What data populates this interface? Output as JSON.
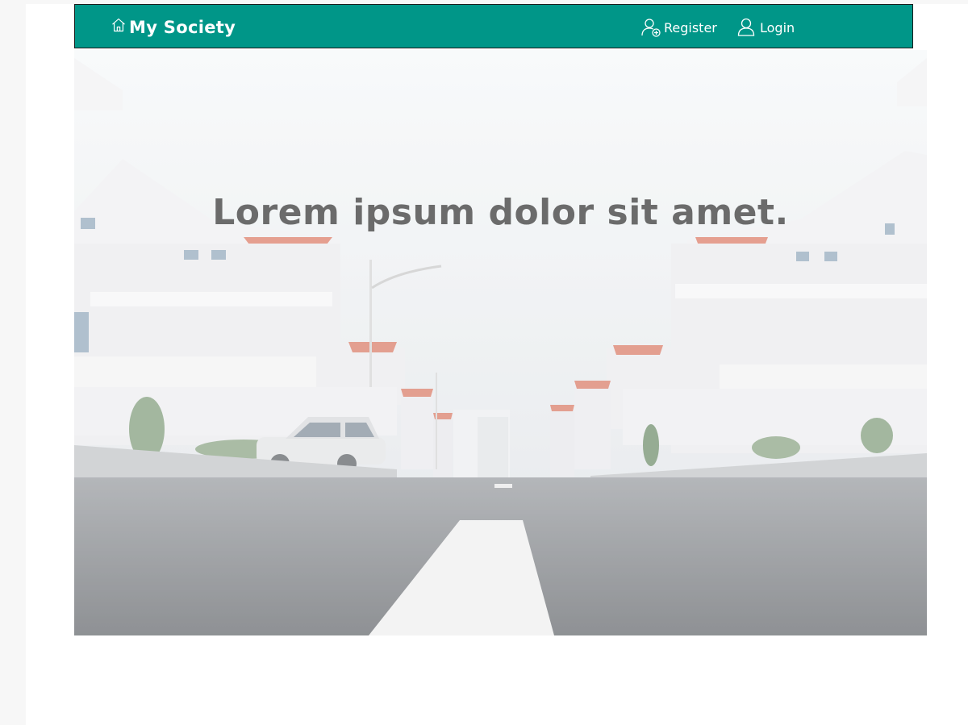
{
  "navbar": {
    "brand": "My Society",
    "brand_icon": "home-icon",
    "links": [
      {
        "label": "Register",
        "icon": "user-add-icon"
      },
      {
        "label": "Login",
        "icon": "user-icon"
      }
    ],
    "background_color": "#009688",
    "text_color": "#ffffff"
  },
  "hero": {
    "title": "Lorem ipsum dolor sit amet.",
    "image": "residential-street-houses-image",
    "title_color": "#6b6b6b"
  }
}
